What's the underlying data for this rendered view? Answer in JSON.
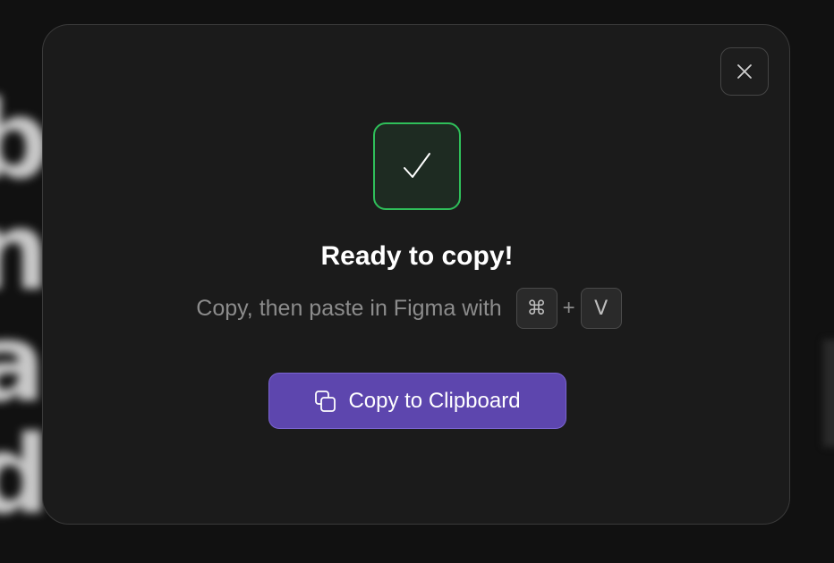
{
  "background": {
    "blurred_text": "b\nn\na\nd"
  },
  "modal": {
    "title": "Ready to copy!",
    "subtitle": "Copy, then paste in Figma with",
    "shortcut": {
      "modifier_key": "⌘",
      "plus": "+",
      "letter_key": "V"
    },
    "copy_button": {
      "label": "Copy to Clipboard",
      "icon": "copy-icon"
    },
    "close_icon": "close-icon",
    "status_icon": "checkmark-icon"
  },
  "colors": {
    "modal_bg": "#1b1b1b",
    "success_green": "#2fbf5a",
    "accent_purple": "#5d46ae",
    "muted_text": "#8c8c8c"
  }
}
